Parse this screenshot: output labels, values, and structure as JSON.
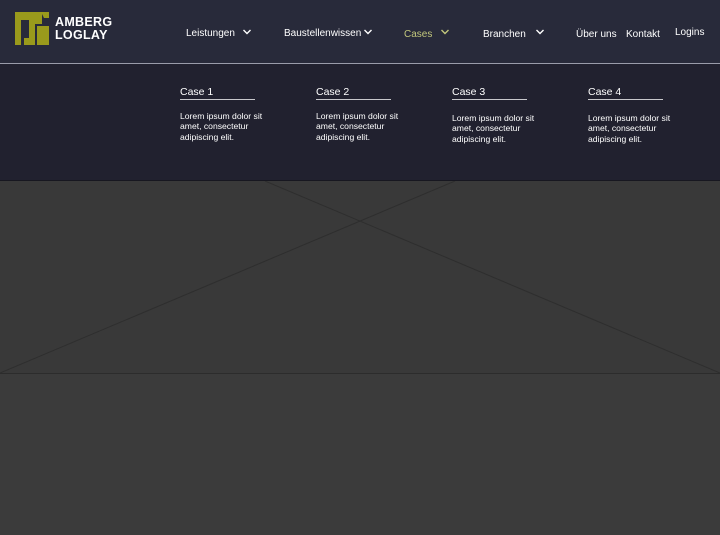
{
  "brand": {
    "name_line1": "AMBERG",
    "name_line2": "LOGLAY",
    "logo_icon": "amberg-logo-mark",
    "accent_color": "#9a9a1c"
  },
  "nav": {
    "items": [
      {
        "label": "Leistungen",
        "has_dropdown": true
      },
      {
        "label": "Baustellenwissen",
        "has_dropdown": true
      },
      {
        "label": "Cases",
        "has_dropdown": true,
        "active": true
      },
      {
        "label": "Branchen",
        "has_dropdown": true
      },
      {
        "label": "Über uns",
        "has_dropdown": false
      },
      {
        "label": "Kontakt",
        "has_dropdown": false
      }
    ],
    "logins_label": "Logins",
    "active_color": "#c2c77c"
  },
  "dropdown": {
    "cases": [
      {
        "title": "Case 1",
        "text": "Lorem ipsum dolor sit amet, consectetur adipiscing elit."
      },
      {
        "title": "Case 2",
        "text": "Lorem ipsum dolor sit amet, consectetur adipiscing elit."
      },
      {
        "title": "Case 3",
        "text": "Lorem ipsum dolor sit amet, consectetur adipiscing elit."
      },
      {
        "title": "Case 4",
        "text": "Lorem ipsum dolor sit amet, consectetur adipiscing elit."
      }
    ]
  },
  "hero": {
    "placeholder_icon": "image-placeholder-icon"
  }
}
